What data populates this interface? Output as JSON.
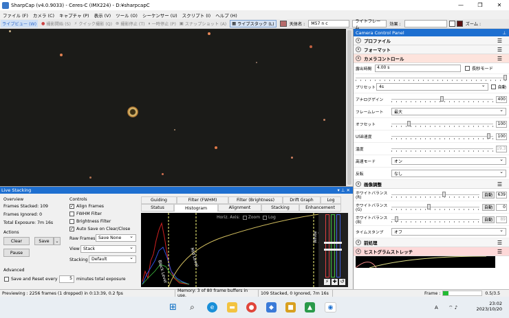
{
  "window": {
    "title": "SharpCap (v4.0.9033) - Ceres-C (IMX224) - D:¥sharpcapC"
  },
  "menu": [
    "ファイル (F)",
    "カメラ (C)",
    "キャプチャ (P)",
    "表示 (V)",
    "ツール (O)",
    "シーケンサー (U)",
    "スクリプト (I)",
    "ヘルプ (H)"
  ],
  "toolbar": {
    "preview": "ライブビュー (W)",
    "start_capture": "撮影開始 (S)",
    "quick_capture": "クイック撮影 (Q)",
    "stop_capture": "撮影停止 (T)",
    "pause": "一時停止 (P)",
    "snapshot": "スナップショット (A)",
    "live_stack": "ライブスタック (L)",
    "target_label": "天体名 :",
    "target_value": "M57 n c",
    "frame_label": "ライトフレーム",
    "effect_label": "効果 :",
    "zoom_label": "ズーム :"
  },
  "ccp": {
    "title": "Camera Control Panel",
    "sections": {
      "profile": "プロファイル",
      "format": "フォーマット",
      "camera_control": "カメラコントロール",
      "image_adjust": "画像調整",
      "preprocess": "前処理",
      "histogram_stretch": "ヒストグラムストレッチ"
    },
    "exposure_label": "露出時間",
    "exposure_value": "4.00 s",
    "long_exp_mode": "長秒モード",
    "preset_label": "プリセット",
    "preset_value": "4s",
    "auto_label": "自動",
    "rows": [
      {
        "label": "アナログゲイン",
        "value": "400",
        "pos": 0.5
      },
      {
        "label": "フレームレート",
        "dropdown": "最大"
      },
      {
        "label": "オフセット",
        "value": "100",
        "pos": 0.16
      },
      {
        "label": "USB速度",
        "value": "100",
        "pos": 0.98
      },
      {
        "label": "温度",
        "value": "19.3",
        "disabled": true
      },
      {
        "label": "高速モード",
        "dropdown": "オン"
      },
      {
        "label": "反転",
        "dropdown": "なし"
      }
    ],
    "image_rows": [
      {
        "label": "ホワイトバランス(R)",
        "value": "639",
        "pos": 0.6,
        "auto": "自動"
      },
      {
        "label": "ホワイトバランス(G)",
        "value": "0",
        "pos": 0.42,
        "auto": "自動"
      },
      {
        "label": "ホワイトバランス(B)",
        "value": "89",
        "pos": 0.04,
        "auto": "自動",
        "disabled": true
      },
      {
        "label": "タイムスタンプ",
        "dropdown": "オフ"
      }
    ]
  },
  "live_stacking": {
    "title": "Live Stacking",
    "overview_label": "Overview",
    "frames_stacked": "Frames Stacked: 109",
    "frames_ignored": "Frames Ignored: 0",
    "total_exposure": "Total Exposure: 7m 16s",
    "actions_label": "Actions",
    "clear_btn": "Clear",
    "save_btn": "Save",
    "pause_btn": "Pause",
    "advanced_label": "Advanced",
    "save_reset": "Save and Reset every",
    "save_reset_value": "5",
    "minutes_total": "minutes total exposure",
    "controls_label": "Controls",
    "align_frames": "Align Frames",
    "fwhm_filter": "FWHM Filter",
    "brightness_filter": "Brightness Filter",
    "auto_save": "Auto Save on Clear/Close",
    "raw_frames_label": "Raw Frames",
    "raw_frames_value": "Save None",
    "view_label": "View",
    "view_value": "Stack",
    "stacking_label": "Stacking",
    "stacking_value": "Default",
    "tabs_top": [
      "Guiding",
      "Filter (FWHM)",
      "Filter (Brightness)",
      "Drift Graph",
      "Log"
    ],
    "tabs_bottom": [
      "Status",
      "Histogram",
      "Alignment",
      "Stacking",
      "Enhancement"
    ],
    "horiz_axis": "Horiz. Axis:",
    "zoom": "Zoom",
    "log": "Log",
    "black_level": "Black Level",
    "mid_level": "Mid Level",
    "white_level": "White Level"
  },
  "statusbar": {
    "preview": "Previewing : 2256 frames (1 dropped) in 0:13:39, 0.2 fps",
    "memory": "Memory: 3 of 80 frame buffers in use.",
    "stacked": "109 Stacked, 0 Ignored, 7m 16s",
    "frame_label": "Frame :",
    "frame_value": "0.5/3.5",
    "frame_progress": 0.14
  },
  "taskbar": {
    "time": "23:02",
    "date": "2023/10/20",
    "lang": "A"
  },
  "colors": {
    "accent": "#1e6fd0",
    "pink": "#fde3dc"
  }
}
